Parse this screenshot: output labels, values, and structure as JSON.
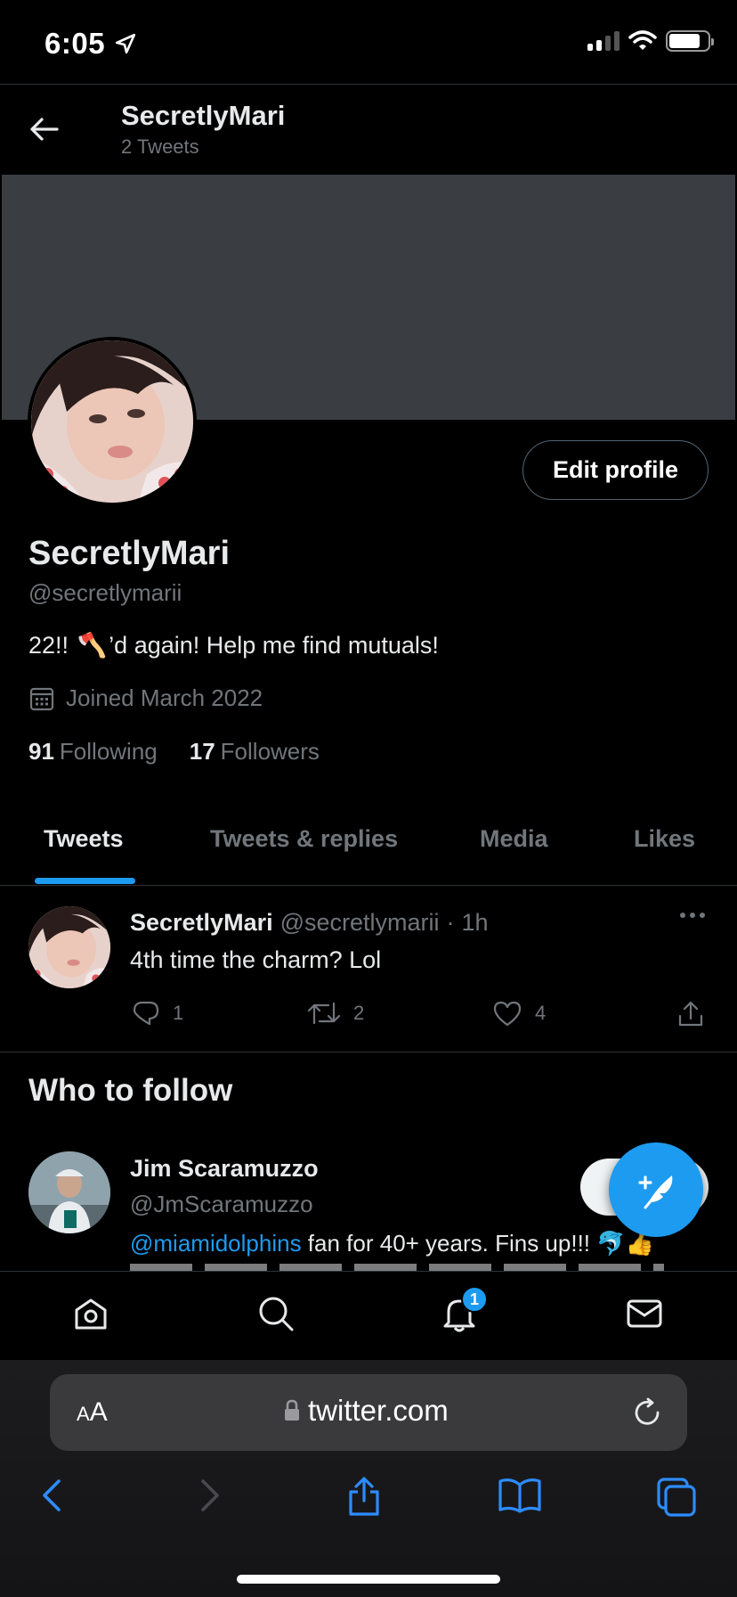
{
  "status_bar": {
    "time": "6:05"
  },
  "header": {
    "title": "SecretlyMari",
    "subtitle": "2 Tweets"
  },
  "profile": {
    "name": "SecretlyMari",
    "handle": "@secretlymarii",
    "bio_before": "22!! ",
    "bio_emoji": "🪓",
    "bio_after": "’d again! Help me find mutuals!",
    "joined": "Joined March 2022",
    "following_count": "91",
    "following_label": "Following",
    "followers_count": "17",
    "followers_label": "Followers",
    "edit_button": "Edit profile"
  },
  "tabs": [
    {
      "label": "Tweets",
      "active": true
    },
    {
      "label": "Tweets & replies",
      "active": false
    },
    {
      "label": "Media",
      "active": false
    },
    {
      "label": "Likes",
      "active": false
    }
  ],
  "tweet": {
    "name": "SecretlyMari",
    "handle": "@secretlymarii",
    "separator": "·",
    "time": "1h",
    "text": "4th time the charm? Lol",
    "replies": "1",
    "retweets": "2",
    "likes": "4"
  },
  "who_to_follow": {
    "title": "Who to follow",
    "user": {
      "name": "Jim Scaramuzzo",
      "handle": "@JmScaramuzzo",
      "bio_mention": "@miamidolphins",
      "bio_text": " fan for 40+ years. Fins up!!! 🐬👍"
    }
  },
  "bottom_nav": {
    "notification_badge": "1"
  },
  "safari": {
    "aa_label_big": "A",
    "aa_label_small": "A",
    "url": "twitter.com"
  },
  "colors": {
    "accent": "#1d9bf0",
    "background": "#000000",
    "muted": "#71767b"
  }
}
